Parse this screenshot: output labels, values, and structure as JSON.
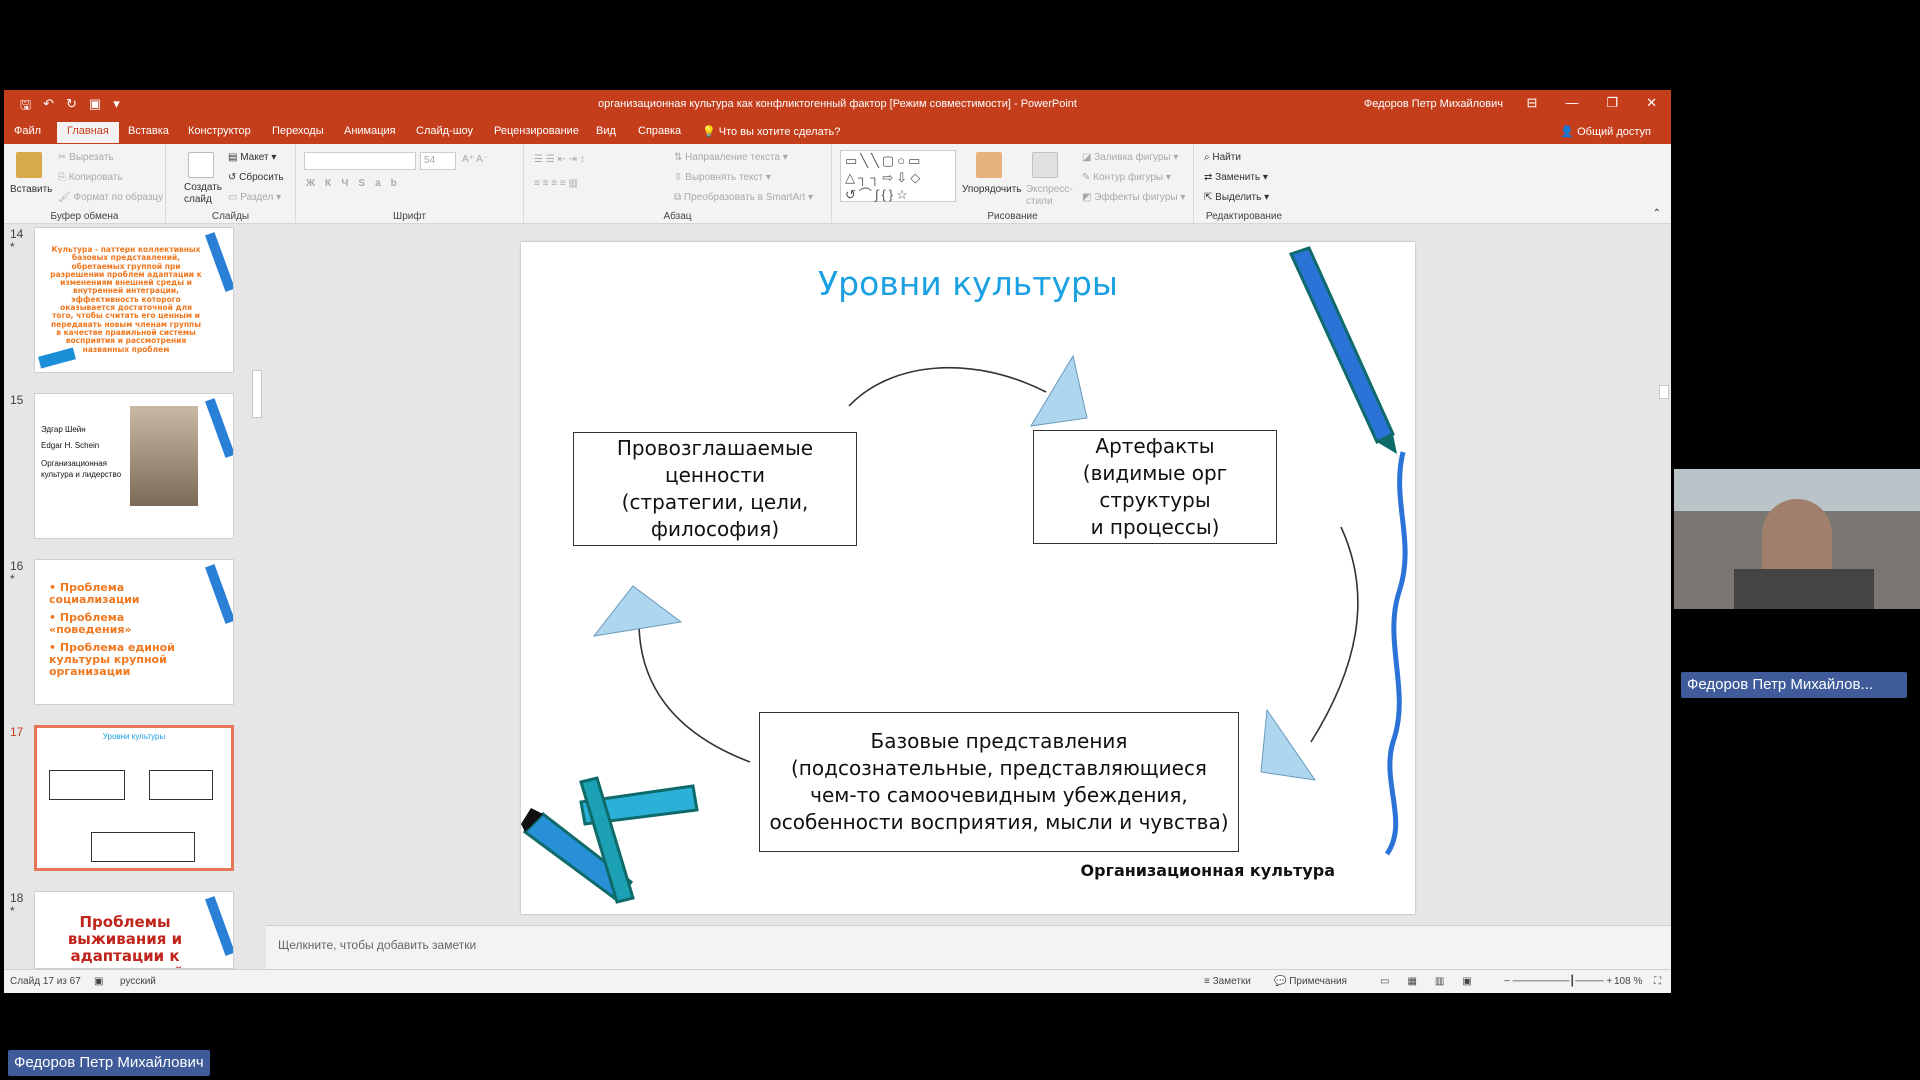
{
  "window": {
    "title": "организационная культура как конфликтогенный фактор [Режим совместимости]  -  PowerPoint",
    "user": "Федоров Петр Михайлович",
    "qat_icons": [
      "save-icon",
      "undo-icon",
      "redo-icon",
      "start-slideshow-icon",
      "customize-icon"
    ]
  },
  "menu": {
    "tabs": [
      "Файл",
      "Главная",
      "Вставка",
      "Конструктор",
      "Переходы",
      "Анимация",
      "Слайд-шоу",
      "Рецензирование",
      "Вид",
      "Справка"
    ],
    "active_tab": "Главная",
    "tell_me": "Что вы хотите сделать?",
    "share": "Общий доступ"
  },
  "ribbon": {
    "clipboard": {
      "paste": "Вставить",
      "cut": "Вырезать",
      "copy": "Копировать",
      "format_painter": "Формат по образцу",
      "label": "Буфер обмена"
    },
    "slides": {
      "new_slide": "Создать слайд",
      "layout": "Макет",
      "reset": "Сбросить",
      "section": "Раздел",
      "label": "Слайды"
    },
    "font": {
      "font_name": "",
      "font_size": "54",
      "label": "Шрифт"
    },
    "paragraph": {
      "text_direction": "Направление текста",
      "align_text": "Выровнять текст",
      "smartart": "Преобразовать в SmartArt",
      "label": "Абзац"
    },
    "drawing": {
      "arrange": "Упорядочить",
      "quick_styles": "Экспресс-стили",
      "shape_fill": "Заливка фигуры",
      "shape_outline": "Контур фигуры",
      "shape_effects": "Эффекты фигуры",
      "label": "Рисование"
    },
    "editing": {
      "find": "Найти",
      "replace": "Заменить",
      "select": "Выделить",
      "label": "Редактирование"
    }
  },
  "thumbnails": [
    {
      "num": "14",
      "star": "*",
      "text": "Культура - паттерн коллективных базовых представлений, обретаемых группой при разрешении проблем адаптации к изменениям внешней среды и внутренней интеграции, эффективность которого оказывается достаточной для того, чтобы считать его ценным и передавать новым членам группы в качестве правильной системы восприятия и рассмотрения названных проблем"
    },
    {
      "num": "15",
      "star": "",
      "lines": [
        "Эдгар Шейн",
        "Edgar H. Schein",
        "Организационная культура и лидерство"
      ]
    },
    {
      "num": "16",
      "star": "*",
      "items": [
        "Проблема социализации",
        "Проблема «поведения»",
        "Проблема единой культуры крупной организации"
      ]
    },
    {
      "num": "17",
      "star": "",
      "title": "Уровни культуры"
    },
    {
      "num": "18",
      "star": "*",
      "text": "Проблемы выживания и адаптации к окружающей среде"
    }
  ],
  "slide": {
    "title": "Уровни культуры",
    "box_values": "Провозглашаемые ценности\n(стратегии, цели, философия)",
    "box_artifacts": "Артефакты\n(видимые орг структуры\nи процессы)",
    "box_basic": "Базовые представления\n(подсознательные, представляющиеся\nчем-то самоочевидным убеждения,\nособенности восприятия, мысли и чувства)",
    "footer": "Организационная культура",
    "footer_small": "Организационная культура"
  },
  "notes_placeholder": "Щелкните, чтобы добавить заметки",
  "status": {
    "slide_of": "Слайд 17 из 67",
    "language": "русский",
    "notes": "Заметки",
    "comments": "Примечания",
    "zoom": "108 %"
  },
  "participant": {
    "cam_name": "Федоров Петр Михайлов...",
    "bottom_name": "Федоров Петр Михайлович"
  },
  "colors": {
    "ppt_accent": "#c43e1c",
    "slide_title": "#1ba0e2",
    "name_badge": "#3f5b9a"
  }
}
